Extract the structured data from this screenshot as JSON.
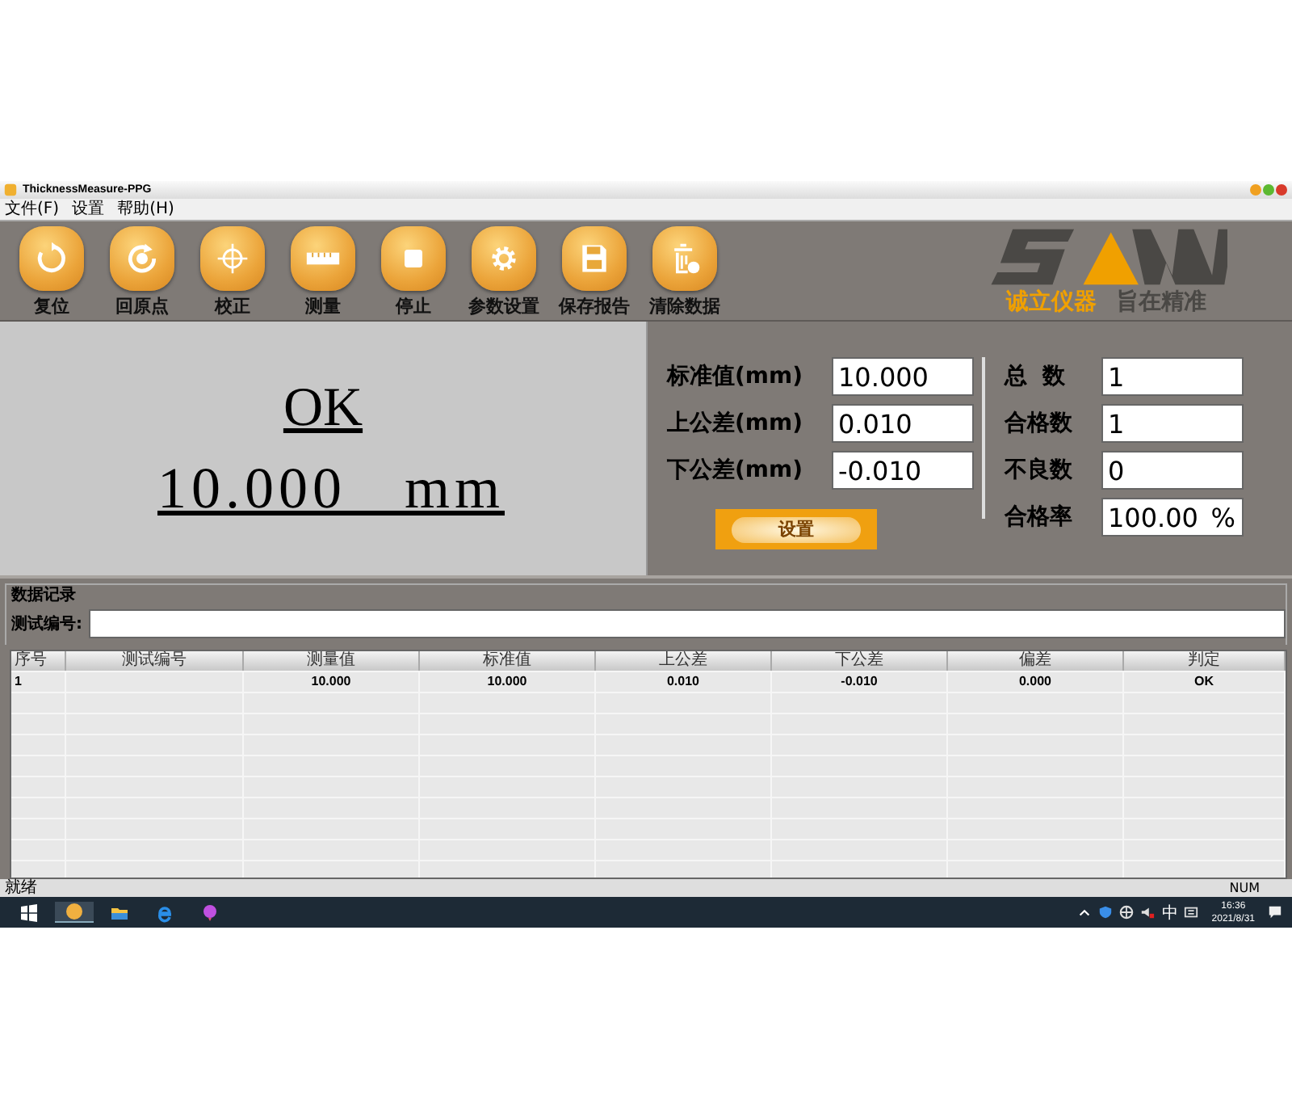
{
  "window": {
    "title": "ThicknessMeasure-PPG"
  },
  "menu": [
    "文件(F)",
    "设置",
    "帮助(H)"
  ],
  "toolbar": [
    {
      "label": "复位",
      "kind": "reset"
    },
    {
      "label": "回原点",
      "kind": "home"
    },
    {
      "label": "校正",
      "kind": "calibrate"
    },
    {
      "label": "测量",
      "kind": "measure"
    },
    {
      "label": "停止",
      "kind": "stop"
    },
    {
      "label": "参数设置",
      "kind": "settings"
    },
    {
      "label": "保存报告",
      "kind": "save"
    },
    {
      "label": "清除数据",
      "kind": "clear"
    }
  ],
  "logo": {
    "brand": "诚立仪器",
    "slogan": "旨在精准"
  },
  "result": {
    "verdict": "OK",
    "value": "10.000",
    "unit": "mm"
  },
  "settings": [
    {
      "label": "标准值(mm)",
      "value": "10.000"
    },
    {
      "label": "上公差(mm)",
      "value": "0.010"
    },
    {
      "label": "下公差(mm)",
      "value": "-0.010"
    }
  ],
  "set_button": "设置",
  "stats": [
    {
      "label": "总  数",
      "value": "1"
    },
    {
      "label": "合格数",
      "value": "1"
    },
    {
      "label": "不良数",
      "value": "0"
    },
    {
      "label": "合格率",
      "value": "100.00",
      "unit": "%"
    }
  ],
  "record": {
    "title": "数据记录",
    "label": "测试编号:"
  },
  "table": {
    "columns": [
      "序号",
      "测试编号",
      "测量值",
      "标准值",
      "上公差",
      "下公差",
      "偏差",
      "判定"
    ],
    "rows": [
      [
        "1",
        null,
        "10.000",
        "10.000",
        "0.010",
        "-0.010",
        "0.000",
        "OK"
      ]
    ]
  },
  "status_bar": {
    "left": "就绪",
    "right": "NUM"
  },
  "taskbar": {
    "ime": "中",
    "time": "16:36",
    "date": "2021/8/31"
  }
}
